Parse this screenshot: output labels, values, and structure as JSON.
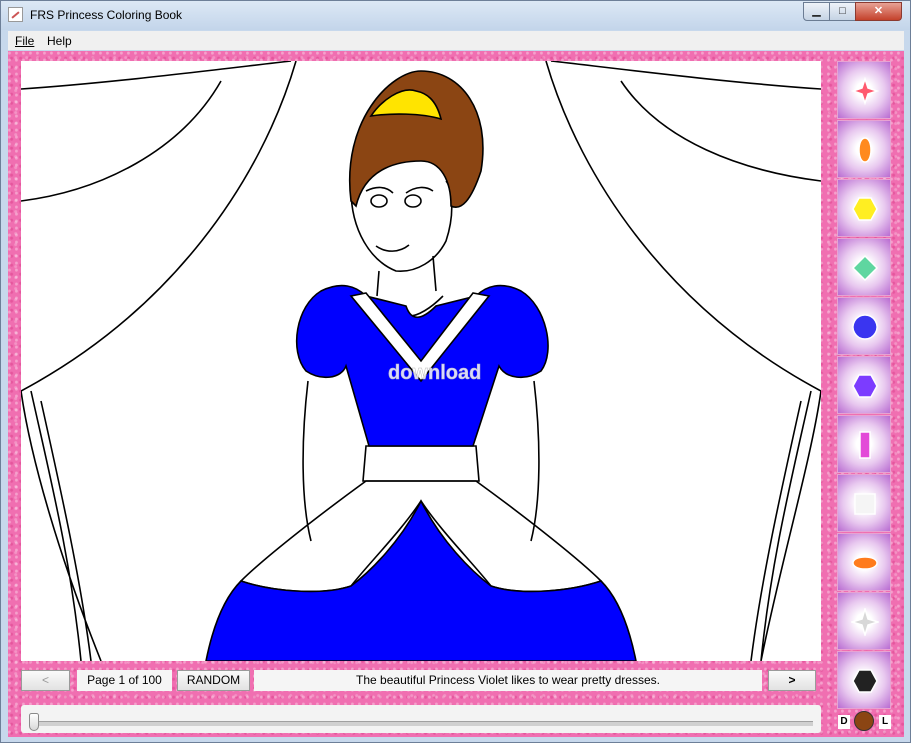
{
  "window": {
    "title": "FRS Princess Coloring Book",
    "controls": {
      "minimize": "▁",
      "maximize": "□",
      "close": "✕"
    }
  },
  "menu": {
    "file": "File",
    "help": "Help"
  },
  "canvas": {
    "colors": {
      "hair": "#8b4513",
      "crown": "#ffe400",
      "dress": "#0000ff",
      "lines": "#000000",
      "background": "#ffffff"
    },
    "watermark": "download"
  },
  "palette": {
    "swatches": [
      {
        "name": "red-star-gem-icon",
        "color": "#ff5a6e"
      },
      {
        "name": "orange-oval-gem-icon",
        "color": "#ff8a1e"
      },
      {
        "name": "yellow-hexagon-gem-icon",
        "color": "#ffee22"
      },
      {
        "name": "green-diamond-gem-icon",
        "color": "#5fd6a0"
      },
      {
        "name": "blue-round-gem-icon",
        "color": "#3a35f0"
      },
      {
        "name": "purple-hexagon-gem-icon",
        "color": "#7c3cff"
      },
      {
        "name": "magenta-bar-gem-icon",
        "color": "#e34bd8"
      },
      {
        "name": "white-square-gem-icon",
        "color": "#f5f5f5"
      },
      {
        "name": "orange-ellipse-gem-icon",
        "color": "#ff7b1c"
      },
      {
        "name": "silver-star-gem-icon",
        "color": "#d8d8d8"
      },
      {
        "name": "black-hexagon-gem-icon",
        "color": "#222222"
      }
    ],
    "current_color": "#8b4513",
    "dark_label": "D",
    "light_label": "L"
  },
  "nav": {
    "prev_label": "<",
    "page_label": "Page 1 of 100",
    "random_label": "RANDOM",
    "caption": "The beautiful Princess Violet likes to wear pretty dresses.",
    "next_label": ">"
  },
  "slider": {
    "value": 0
  }
}
